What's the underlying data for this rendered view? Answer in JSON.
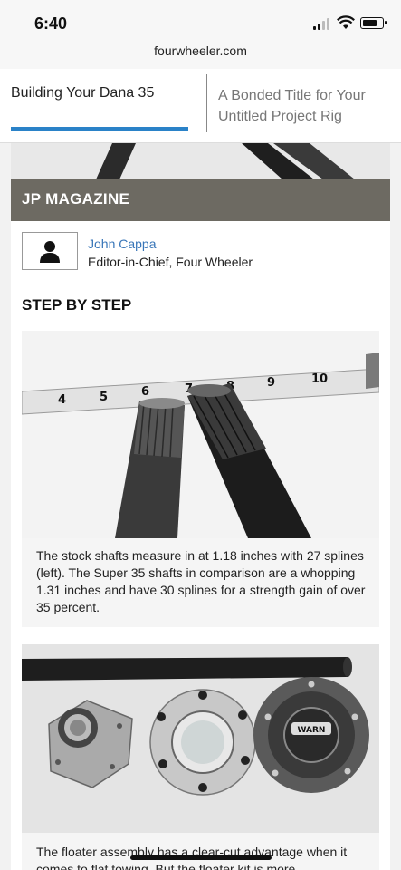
{
  "status_bar": {
    "time": "6:40",
    "icons": [
      "signal-icon",
      "wifi-icon",
      "battery-icon"
    ]
  },
  "browser": {
    "url": "fourwheeler.com"
  },
  "tabs": [
    {
      "label": "Building Your Dana 35",
      "active": true
    },
    {
      "label": "A Bonded Title for Your Untitled Project Rig",
      "active": false
    }
  ],
  "magazine": {
    "name": "JP MAGAZINE"
  },
  "author": {
    "name": "John Cappa",
    "title": "Editor-in-Chief, Four Wheeler",
    "icon": "user-icon"
  },
  "section": {
    "heading": "STEP BY STEP"
  },
  "steps": [
    {
      "image": "axle-shafts-with-tape-measure-photo",
      "tape_numbers": [
        "4",
        "5",
        "6",
        "7",
        "8",
        "9",
        "10"
      ],
      "caption": "The stock shafts measure in at 1.18 inches with 27 splines (left). The Super 35 shafts in comparison are a whopping 1.31 inches and have 30 splines for a strength gain of over 35 percent."
    },
    {
      "image": "floater-assembly-parts-photo",
      "hub_label": "WARN",
      "caption": "The floater assembly has a clear-cut advantage when it comes to flat towing. But the floater kit is more"
    }
  ],
  "colors": {
    "accent": "#2a82c8",
    "magazine_bar": "#6d6a62",
    "link": "#3775b8"
  }
}
